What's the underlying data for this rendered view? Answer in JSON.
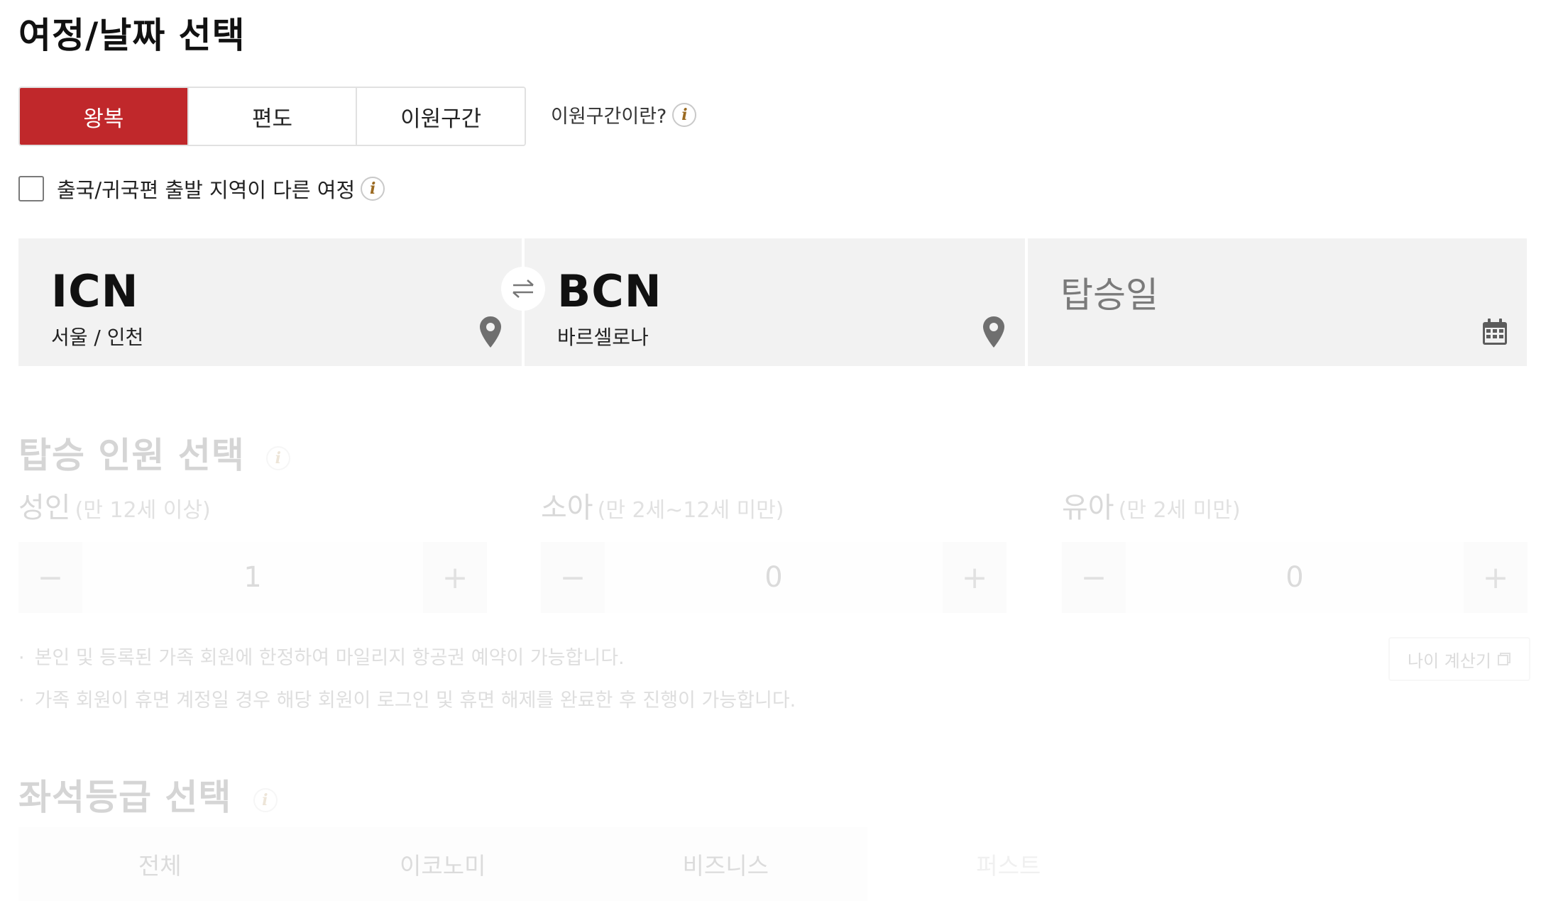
{
  "section_itinerary": {
    "title": "여정/날짜 선택"
  },
  "trip_tabs": [
    {
      "label": "왕복",
      "active": true
    },
    {
      "label": "편도",
      "active": false
    },
    {
      "label": "이원구간",
      "active": false
    }
  ],
  "mixed_help": {
    "label": "이원구간이란?",
    "icon": "info-icon"
  },
  "different_origin": {
    "label": "출국/귀국편 출발 지역이 다른 여정",
    "checked": false
  },
  "origin": {
    "code": "ICN",
    "city": "서울 / 인천",
    "icon": "map-pin-icon"
  },
  "swap": {
    "icon": "swap-arrows-icon"
  },
  "destination": {
    "code": "BCN",
    "city": "바르셀로나",
    "icon": "map-pin-icon"
  },
  "departure_date": {
    "placeholder": "탑승일",
    "icon": "calendar-icon"
  },
  "section_passengers": {
    "title": "탑승 인원 선택",
    "adult": {
      "label": "성인",
      "sub": "(만 12세 이상)",
      "value": "1"
    },
    "child": {
      "label": "소아",
      "sub": "(만 2세~12세 미만)",
      "value": "0"
    },
    "infant": {
      "label": "유아",
      "sub": "(만 2세 미만)",
      "value": "0"
    },
    "minus": "−",
    "plus": "+"
  },
  "notes": [
    "본인 및 등록된 가족 회원에 한정하여 마일리지 항공권 예약이 가능합니다.",
    "가족 회원이 휴면 계정일 경우 해당 회원이 로그인 및 휴면 해제를 완료한 후 진행이 가능합니다."
  ],
  "age_calculator": {
    "label": "나이 계산기"
  },
  "section_seat": {
    "title": "좌석등급 선택",
    "options": [
      "전체",
      "이코노미",
      "비즈니스",
      "퍼스트"
    ]
  },
  "colors": {
    "accent": "#c0282b",
    "panel": "#f2f2f2",
    "info_icon": "#9b6a22"
  }
}
